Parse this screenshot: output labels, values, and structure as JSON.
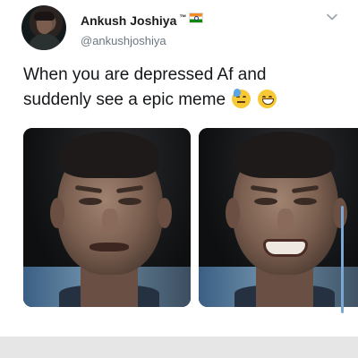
{
  "tweet": {
    "author_name": "Ankush Joshiya",
    "author_badge": "™",
    "author_handle": "@ankushjoshiya",
    "text_line1": "When you are depressed Af and",
    "text_line2": "suddenly see a epic meme",
    "emojis": [
      "sweat-face-emoji",
      "grin-face-emoji"
    ],
    "flag": "india-flag-icon",
    "menu_icon": "chevron-down-icon"
  },
  "media": {
    "images": [
      "crying-man-photo",
      "smiling-through-tears-photo"
    ]
  },
  "colors": {
    "text": "#14171a",
    "handle": "#6b7680",
    "scrollbar": "#7aa7d6",
    "bottom_bar": "#e6e6e6"
  }
}
